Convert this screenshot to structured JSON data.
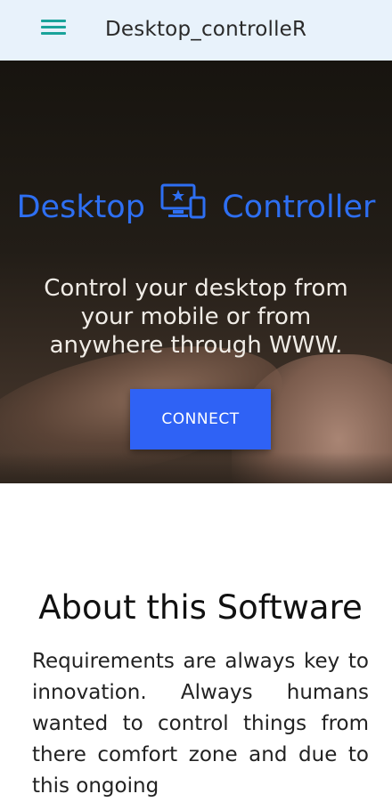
{
  "appbar": {
    "menu_icon": "hamburger-menu-icon",
    "title": "Desktop_controlleR"
  },
  "hero": {
    "brand_left": "Desktop",
    "brand_icon": "desktop-devices-icon",
    "brand_right": "Controller",
    "tagline": "Control your desktop from your mobile or from anywhere through WWW.",
    "connect_label": "CONNECT"
  },
  "about": {
    "title": "About this Software",
    "text": "Requirements are always key to innovation. Always humans wanted to control things from there comfort zone and due to this ongoing"
  },
  "colors": {
    "appbar_bg": "#e8f2fb",
    "menu_icon": "#1aa39a",
    "brand_blue": "#2e6ff2",
    "button_bg": "#2f62f5"
  }
}
